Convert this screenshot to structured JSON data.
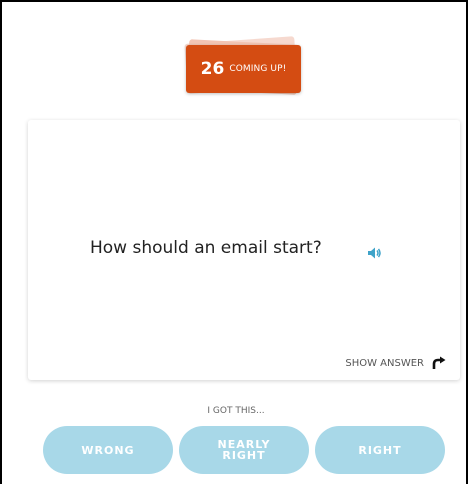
{
  "badge": {
    "count": "26",
    "label": "COMING UP!",
    "color": "#d44c12"
  },
  "card": {
    "question": "How should an email start?",
    "speaker_icon": "speaker-icon",
    "show_answer_label": "SHOW ANSWER",
    "show_answer_icon": "redo-arrow-icon"
  },
  "rating": {
    "prompt": "I GOT THIS...",
    "buttons": {
      "wrong": "WRONG",
      "nearly_line1": "NEARLY",
      "nearly_line2": "RIGHT",
      "right": "RIGHT"
    },
    "button_color": "#a8d8e8"
  },
  "accent_color": "#3fa3c9"
}
